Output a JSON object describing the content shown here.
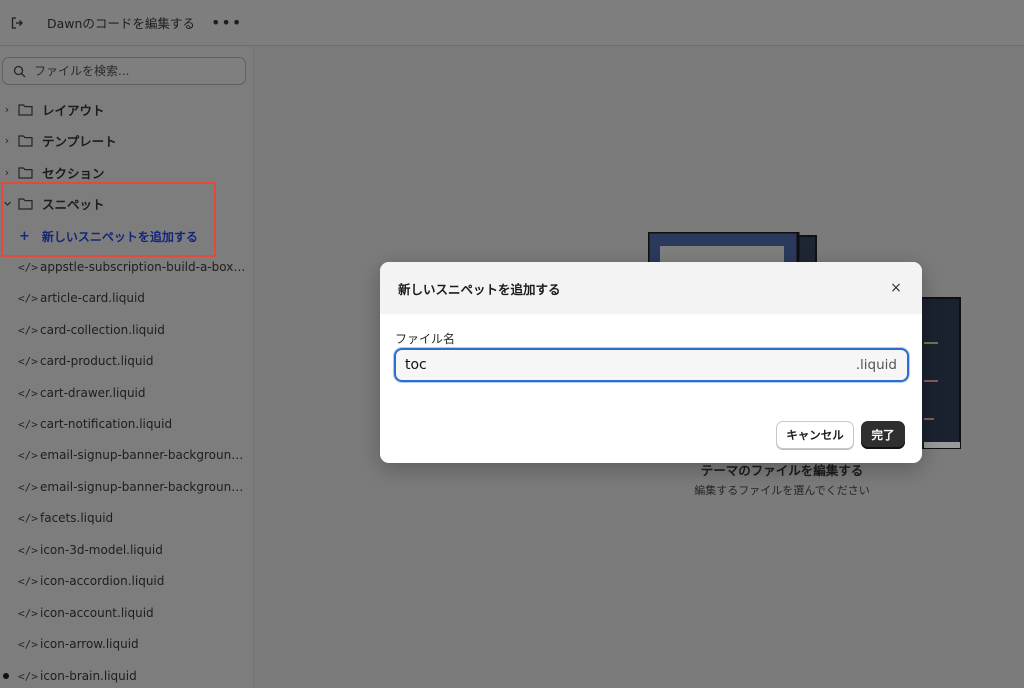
{
  "topbar": {
    "title": "Dawnのコードを編集する",
    "more_label": "•••",
    "exit_icon": "exit-icon"
  },
  "sidebar": {
    "search_placeholder": "ファイルを検索...",
    "folders": [
      {
        "label": "レイアウト",
        "expanded": false
      },
      {
        "label": "テンプレート",
        "expanded": false
      },
      {
        "label": "セクション",
        "expanded": false
      },
      {
        "label": "スニペット",
        "expanded": true
      }
    ],
    "add_snippet": {
      "plus": "+",
      "label": "新しいスニペットを追加する"
    },
    "files": [
      {
        "name": "appstle-subscription-build-a-box-v...",
        "modified": false
      },
      {
        "name": "article-card.liquid",
        "modified": false
      },
      {
        "name": "card-collection.liquid",
        "modified": false
      },
      {
        "name": "card-product.liquid",
        "modified": false
      },
      {
        "name": "cart-drawer.liquid",
        "modified": false
      },
      {
        "name": "cart-notification.liquid",
        "modified": false
      },
      {
        "name": "email-signup-banner-background-...",
        "modified": false
      },
      {
        "name": "email-signup-banner-background.li...",
        "modified": false
      },
      {
        "name": "facets.liquid",
        "modified": false
      },
      {
        "name": "icon-3d-model.liquid",
        "modified": false
      },
      {
        "name": "icon-accordion.liquid",
        "modified": false
      },
      {
        "name": "icon-account.liquid",
        "modified": false
      },
      {
        "name": "icon-arrow.liquid",
        "modified": false
      },
      {
        "name": "icon-brain.liquid",
        "modified": true
      }
    ],
    "code_glyph": "</>",
    "chevron_right": "›",
    "chevron_down": "⌄"
  },
  "empty_state": {
    "title": "テーマのファイルを編集する",
    "subtitle": "編集するファイルを選んでください"
  },
  "modal": {
    "title": "新しいスニペットを追加する",
    "close_label": "×",
    "field_label": "ファイル名",
    "field_value": "toc",
    "field_suffix": ".liquid",
    "cancel_label": "キャンセル",
    "done_label": "完了"
  },
  "colors": {
    "highlight": "#e24a3b",
    "link": "#13267a",
    "focus": "#2c6ecb",
    "primary_button": "#2f2f2f"
  }
}
